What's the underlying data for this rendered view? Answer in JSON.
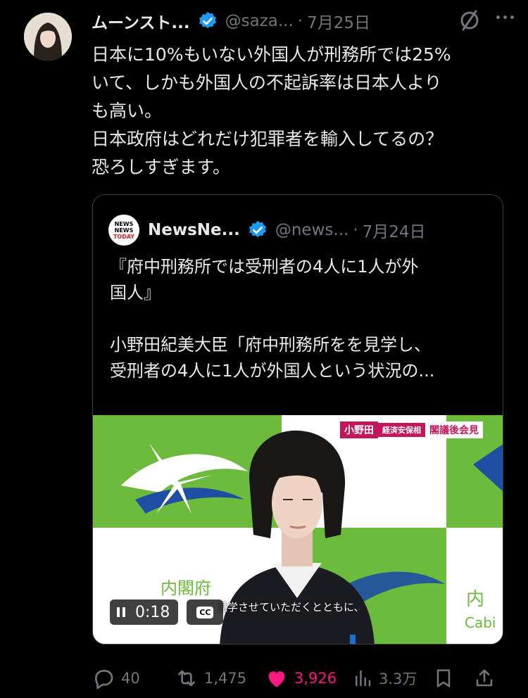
{
  "tweet": {
    "author_name": "ムーンスト...",
    "author_handle": "@saza...",
    "date": "7月25日",
    "text": "日本に10%もいない外国人が刑務所では25%\nいて、しかも外国人の不起訴率は日本人より\nも高い。\n日本政府はどれだけ犯罪者を輸入してるの？\n恐ろしすぎます。"
  },
  "quote": {
    "author_name": "NewsNe...",
    "author_handle": "@news...",
    "date": "7月24日",
    "logo_text": [
      "NEWS",
      "NEWS",
      "TODAY"
    ],
    "text": "『府中刑務所では受刑者の4人に1人が外\n国人』\n\n小野田紀美大臣「府中刑務所をを見学し、\n受刑者の4人に1人が外国人という状況の...",
    "video": {
      "time": "0:18",
      "cc_label": "CC",
      "subtitle": "見学させていただくとともに、",
      "banner_name": "小野田",
      "banner_role": "経済安保相",
      "banner_event": "閣議後会見",
      "wall_text_1": "内閣府",
      "wall_text_2": "Cabinet Office",
      "wall_text_3": "内",
      "wall_text_4": "Cabi"
    }
  },
  "actions": {
    "replies": "40",
    "reposts": "1,475",
    "likes": "3,926",
    "views": "3.3万"
  },
  "colors": {
    "background": "#000000",
    "text": "#e7e9ea",
    "muted": "#71767b",
    "verified": "#1d9bf0",
    "like": "#f91880",
    "border": "#3a3f44"
  }
}
